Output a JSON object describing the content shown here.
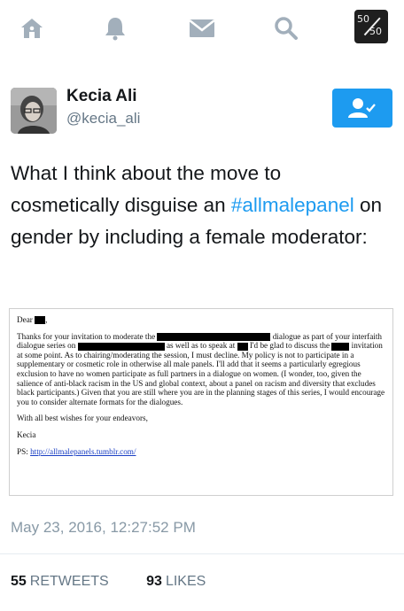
{
  "nav": {
    "icons": [
      "home-icon",
      "notifications-icon",
      "messages-icon",
      "search-icon",
      "profile-avatar"
    ],
    "profile_badge": {
      "top": "50",
      "bottom": "50"
    }
  },
  "author": {
    "name": "Kecia Ali",
    "handle": "@kecia_ali"
  },
  "tweet": {
    "text_before": "What I think about the move to cosmetically disguise an ",
    "hashtag": "#allmalepanel",
    "text_after": " on gender by including a female moderator:"
  },
  "letter": {
    "greeting": "Dear",
    "para1_a": "Thanks for your invitation to moderate the",
    "para1_b": "dialogue as part of your interfaith dialogue series on",
    "para1_c": "as well as to speak at",
    "para1_d": "I'd be glad to discuss the",
    "para1_e": "invitation at some point. As to chairing/moderating the session, I must decline. My policy is not to participate in a supplementary or cosmetic role in otherwise all male panels. I'll add that it seems a particularly egregious exclusion to have no women participate as full partners in a dialogue on women. (I wonder, too, given the salience of anti-black racism in the US and global context, about a panel on racism and diversity that excludes black participants.) Given that you are still where you are in the planning stages of this series, I would encourage you to consider alternate formats for the dialogues.",
    "closing": "With all best wishes for your endeavors,",
    "signature": "Kecia",
    "ps_label": "PS:",
    "ps_link": "http://allmalepanels.tumblr.com/"
  },
  "timestamp": "May 23, 2016, 12:27:52 PM",
  "stats": {
    "retweets_count": "55",
    "retweets_label": "RETWEETS",
    "likes_count": "93",
    "likes_label": "LIKES"
  },
  "colors": {
    "accent": "#1d9bf0",
    "icon_gray": "#a2afbb",
    "text_dark": "#14171a",
    "text_muted": "#657786"
  }
}
